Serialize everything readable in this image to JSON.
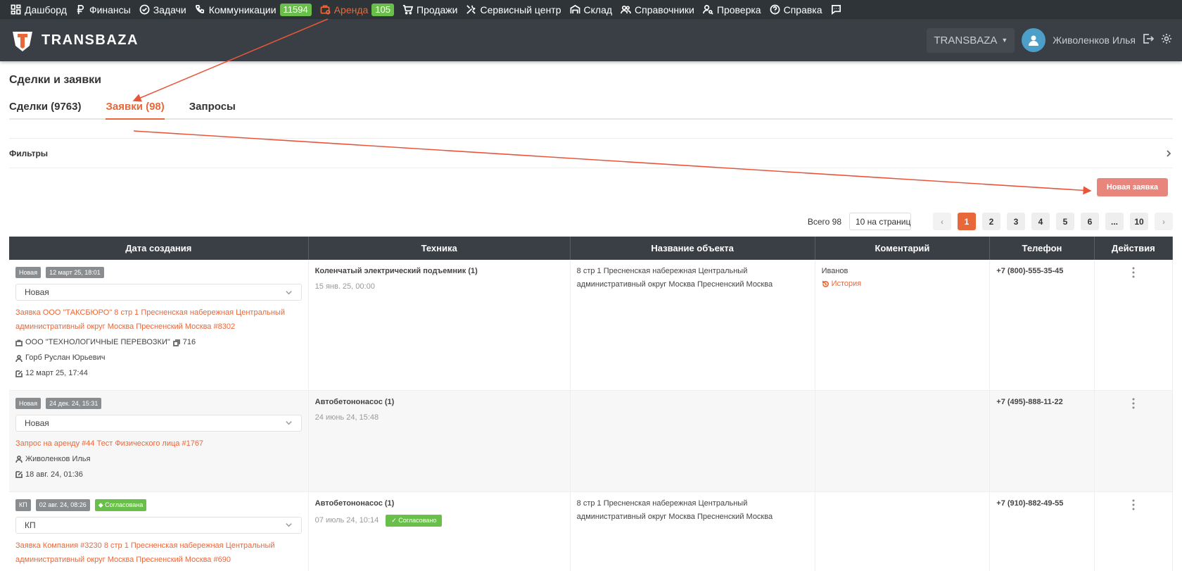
{
  "topnav": {
    "items": [
      {
        "label": "Дашборд",
        "icon": "dashboard-icon"
      },
      {
        "label": "Финансы",
        "icon": "ruble-icon"
      },
      {
        "label": "Задачи",
        "icon": "check-circle-icon"
      },
      {
        "label": "Коммуникации",
        "icon": "phone-icon",
        "badge": "11594"
      },
      {
        "label": "Аренда",
        "icon": "rent-icon",
        "badge": "105",
        "active": true
      },
      {
        "label": "Продажи",
        "icon": "cart-icon"
      },
      {
        "label": "Сервисный центр",
        "icon": "tools-icon"
      },
      {
        "label": "Склад",
        "icon": "warehouse-icon"
      },
      {
        "label": "Справочники",
        "icon": "users-icon"
      },
      {
        "label": "Проверка",
        "icon": "user-search-icon"
      },
      {
        "label": "Справка",
        "icon": "help-icon"
      }
    ]
  },
  "header": {
    "brand": "TRANSBAZA",
    "company": "TRANSBAZA",
    "user": "Живоленков Илья"
  },
  "page": {
    "title": "Сделки и заявки",
    "tabs": [
      "Сделки (9763)",
      "Заявки (98)",
      "Запросы"
    ],
    "filters_label": "Фильтры",
    "new_button": "Новая заявка"
  },
  "pager": {
    "total": "Всего 98",
    "per_page": "10 на странице",
    "pages": [
      "1",
      "2",
      "3",
      "4",
      "5",
      "6",
      "...",
      "10"
    ]
  },
  "table": {
    "headers": [
      "Дата создания",
      "Техника",
      "Название объекта",
      "Коментарий",
      "Телефон",
      "Действия"
    ],
    "rows": [
      {
        "tags": [
          "Новая",
          "12 март 25, 18:01"
        ],
        "status": "Новая",
        "link": "Заявка ООО \"ТАКСБЮРО\" 8 стр 1 Пресненская набережная Центральный административный округ Москва Пресненский Москва #8302",
        "company": "ООО \"ТЕХНОЛОГИЧНЫЕ ПЕРЕВОЗКИ\"",
        "company_num": "716",
        "person": "Горб Руслан Юрьевич",
        "edited": "12 март 25, 17:44",
        "tech": "Коленчатый электрический подъемник (1)",
        "tech_date": "15 янв. 25, 00:00",
        "object": "8 стр 1 Пресненская набережная Центральный административный округ Москва Пресненский Москва",
        "comment": "Иванов",
        "history": "История",
        "phone": "+7 (800)-555-35-45"
      },
      {
        "tags": [
          "Новая",
          "24 дек. 24, 15:31"
        ],
        "status": "Новая",
        "link": "Запрос на аренду #44 Тест Физического лица #1767",
        "person": "Живоленков Илья",
        "edited": "18 авг. 24, 01:36",
        "tech": "Автобетононасос (1)",
        "tech_date": "24 июнь 24, 15:48",
        "phone": "+7 (495)-888-11-22"
      },
      {
        "tags": [
          "КП",
          "02 авг. 24, 08:26"
        ],
        "tag_green": "Согласована",
        "status": "КП",
        "link": "Заявка Компания #3230 8 стр 1 Пресненская набережная Центральный административный округ Москва Пресненский Москва #690",
        "tech": "Автобетононасос (1)",
        "tech_date": "07 июль 24, 10:14",
        "tech_ok": "Согласовано",
        "object": "8 стр 1 Пресненская набережная Центральный административный округ Москва Пресненский Москва",
        "phone": "+7 (910)-882-49-55"
      }
    ]
  },
  "colors": {
    "accent": "#e8683a",
    "nav_bg": "#2f3439",
    "header_bg": "#3a3f45",
    "badge_green": "#6abf4b"
  }
}
